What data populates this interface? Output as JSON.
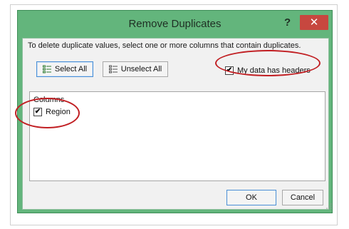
{
  "dialog": {
    "title": "Remove Duplicates",
    "help_label": "?",
    "close_label": "✕"
  },
  "instruction": "To delete duplicate values, select one or more columns that contain duplicates.",
  "buttons": {
    "select_all": "Select All",
    "unselect_all": "Unselect All",
    "ok": "OK",
    "cancel": "Cancel"
  },
  "headers_checkbox": {
    "label": "My data has headers",
    "checked": true,
    "mark": "✔"
  },
  "columns": {
    "header": "Columns",
    "items": [
      {
        "label": "Region",
        "checked": true,
        "mark": "✔"
      }
    ]
  },
  "colors": {
    "window_frame": "#63b57c",
    "close_button": "#c7473f",
    "annotation": "#c11f23"
  },
  "icons": {
    "select_all": "select-all-list-icon",
    "unselect_all": "unselect-all-list-icon"
  }
}
